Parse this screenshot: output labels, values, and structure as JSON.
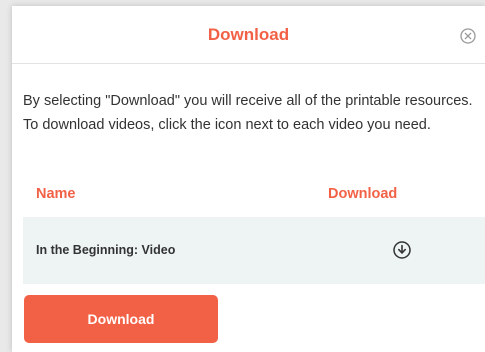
{
  "modal": {
    "title": "Download",
    "intro": "By selecting \"Download\" you will receive all of the printable resources. To download videos, click the icon next to each video you need."
  },
  "table": {
    "headers": {
      "name": "Name",
      "download": "Download"
    },
    "rows": [
      {
        "name": "In the Beginning: Video"
      }
    ]
  },
  "footer": {
    "download_label": "Download"
  },
  "icons": {
    "close": "close-icon",
    "row_download": "download-circle-icon"
  },
  "colors": {
    "accent": "#f26146",
    "row_bg": "#eef4f4",
    "text": "#333333"
  }
}
